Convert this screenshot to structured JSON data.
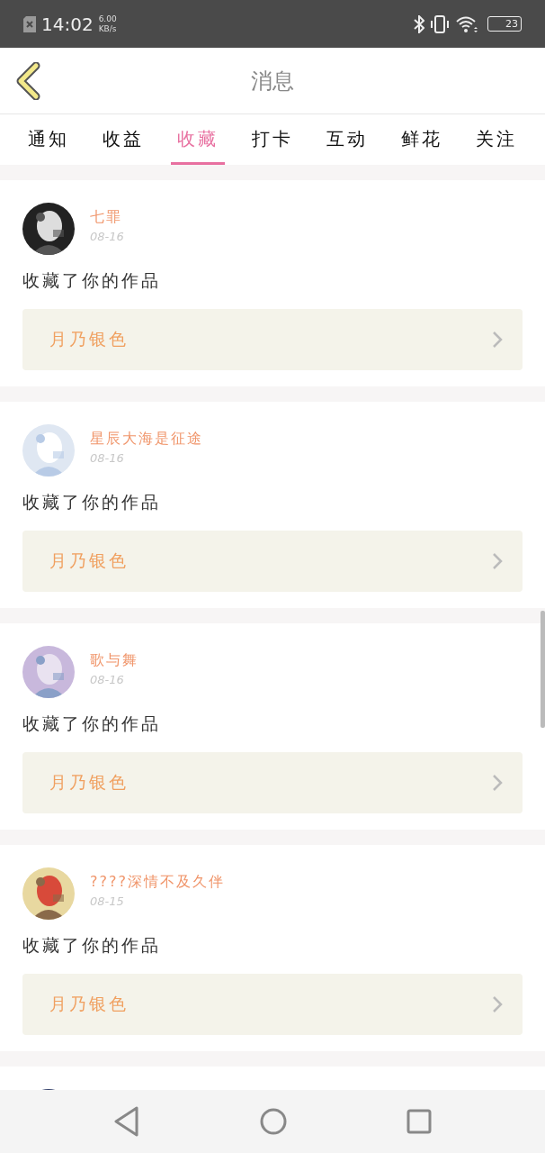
{
  "status_bar": {
    "time": "14:02",
    "speed_value": "6.00",
    "speed_unit": "KB/s",
    "battery": "23"
  },
  "header": {
    "title": "消息"
  },
  "tabs": [
    {
      "label": "通知",
      "selected": false
    },
    {
      "label": "收益",
      "selected": false
    },
    {
      "label": "收藏",
      "selected": true
    },
    {
      "label": "打卡",
      "selected": false
    },
    {
      "label": "互动",
      "selected": false
    },
    {
      "label": "鲜花",
      "selected": false
    },
    {
      "label": "关注",
      "selected": false
    }
  ],
  "messages": [
    {
      "avatar": {
        "kind": "picture"
      },
      "name": "七罪",
      "date": "08-16",
      "action": "收藏了你的作品",
      "work": "月乃银色"
    },
    {
      "avatar": {
        "kind": "picture"
      },
      "name": "星辰大海是征途",
      "date": "08-16",
      "action": "收藏了你的作品",
      "work": "月乃银色"
    },
    {
      "avatar": {
        "kind": "picture"
      },
      "name": "歌与舞",
      "date": "08-16",
      "action": "收藏了你的作品",
      "work": "月乃银色"
    },
    {
      "avatar": {
        "kind": "picture"
      },
      "name": "????深情不及久伴",
      "date": "08-15",
      "action": "收藏了你的作品",
      "work": "月乃银色"
    },
    {
      "avatar": {
        "kind": "picture"
      }
    }
  ]
}
